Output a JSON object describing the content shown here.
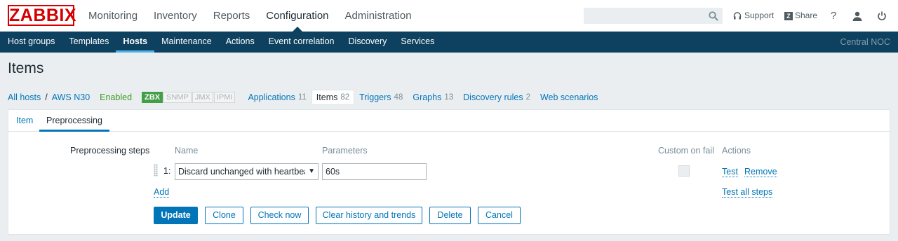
{
  "logo": "ZABBIX",
  "main_menu": [
    "Monitoring",
    "Inventory",
    "Reports",
    "Configuration",
    "Administration"
  ],
  "main_menu_active": "Configuration",
  "top_right": {
    "support": "Support",
    "share": "Share",
    "help": "?",
    "icons": [
      "headset-icon",
      "share-logo-icon",
      "help-icon",
      "user-icon",
      "power-icon"
    ]
  },
  "sub_menu": [
    "Host groups",
    "Templates",
    "Hosts",
    "Maintenance",
    "Actions",
    "Event correlation",
    "Discovery",
    "Services"
  ],
  "sub_menu_active": "Hosts",
  "server_name": "Central NOC",
  "page_title": "Items",
  "breadcrumb": {
    "all_hosts": "All hosts",
    "separator": "/",
    "host": "AWS N30",
    "status": "Enabled",
    "availability": [
      "ZBX",
      "SNMP",
      "JMX",
      "IPMI"
    ],
    "tabs": [
      {
        "label": "Applications",
        "count": "11"
      },
      {
        "label": "Items",
        "count": "82"
      },
      {
        "label": "Triggers",
        "count": "48"
      },
      {
        "label": "Graphs",
        "count": "13"
      },
      {
        "label": "Discovery rules",
        "count": "2"
      },
      {
        "label": "Web scenarios",
        "count": ""
      }
    ]
  },
  "form_tabs": [
    "Item",
    "Preprocessing"
  ],
  "preprocessing": {
    "label": "Preprocessing steps",
    "headers": {
      "name": "Name",
      "parameters": "Parameters",
      "custom_on_fail": "Custom on fail",
      "actions": "Actions"
    },
    "step": {
      "number": "1:",
      "name": "Discard unchanged with heartbeat",
      "parameter": "60s",
      "custom_on_fail": false
    },
    "step_actions": {
      "test": "Test",
      "remove": "Remove"
    },
    "add": "Add",
    "test_all": "Test all steps"
  },
  "buttons": {
    "update": "Update",
    "clone": "Clone",
    "check_now": "Check now",
    "clear_history": "Clear history and trends",
    "delete": "Delete",
    "cancel": "Cancel"
  },
  "colors": {
    "brand_red": "#d40000",
    "nav_bg": "#0e4160",
    "link": "#0275b8",
    "enabled_green": "#3c9a25",
    "zbx_green": "#429e47"
  }
}
